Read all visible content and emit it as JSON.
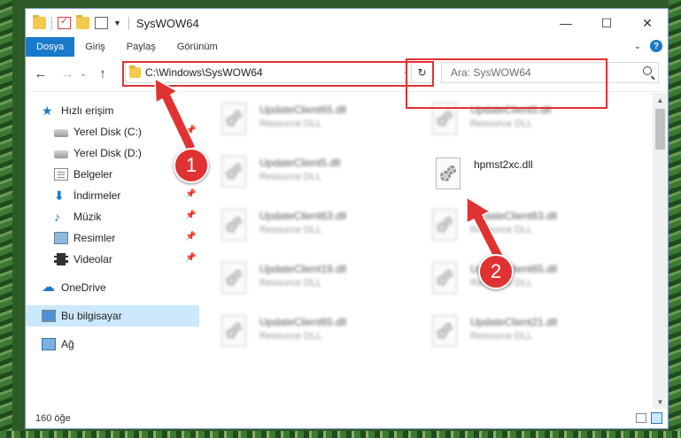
{
  "window": {
    "title": "SysWOW64",
    "minimize": "—",
    "maximize": "☐",
    "close": "✕"
  },
  "ribbon": {
    "tabs": [
      "Dosya",
      "Giriş",
      "Paylaş",
      "Görünüm"
    ],
    "help": "?",
    "expand": "⌄"
  },
  "nav": {
    "back": "←",
    "forward": "→",
    "recent": "⌄",
    "up": "↑",
    "address": "C:\\Windows\\SysWOW64",
    "address_dropdown": "⌄",
    "refresh": "↻",
    "search_placeholder": "Ara: SysWOW64"
  },
  "sidebar": {
    "items": [
      {
        "label": "Hızlı erişim",
        "icon": "star-icon",
        "pinned": false
      },
      {
        "label": "Yerel Disk (C:)",
        "icon": "drive-icon",
        "pinned": true
      },
      {
        "label": "Yerel Disk (D:)",
        "icon": "drive-icon",
        "pinned": false
      },
      {
        "label": "Belgeler",
        "icon": "documents-icon",
        "pinned": false
      },
      {
        "label": "İndirmeler",
        "icon": "downloads-icon",
        "pinned": true
      },
      {
        "label": "Müzik",
        "icon": "music-icon",
        "pinned": true
      },
      {
        "label": "Resimler",
        "icon": "pictures-icon",
        "pinned": true
      },
      {
        "label": "Videolar",
        "icon": "videos-icon",
        "pinned": true
      },
      {
        "label": "OneDrive",
        "icon": "cloud-icon",
        "pinned": false
      },
      {
        "label": "Bu bilgisayar",
        "icon": "pc-icon",
        "pinned": false
      },
      {
        "label": "Ağ",
        "icon": "network-icon",
        "pinned": false
      }
    ],
    "pin_glyph": "📌"
  },
  "files": [
    {
      "name": "UpdateClient65.dll",
      "type": "Resource DLL"
    },
    {
      "name": "UpdateClient5.dll",
      "type": "Resource DLL"
    },
    {
      "name": "UpdateClient5.dll",
      "type": "Resource DLL"
    },
    {
      "name": "hpmst2xc.dll",
      "type": ""
    },
    {
      "name": "UpdateClient63.dll",
      "type": "Resource DLL"
    },
    {
      "name": "UpdateClient63.dll",
      "type": "Resource DLL"
    },
    {
      "name": "UpdateClient19.dll",
      "type": "Resource DLL"
    },
    {
      "name": "UpdateClient65.dll",
      "type": "Resource DLL"
    },
    {
      "name": "UpdateClient65.dll",
      "type": "Resource DLL"
    },
    {
      "name": "UpdateClient21.dll",
      "type": "Resource DLL"
    }
  ],
  "callouts": [
    "1",
    "2"
  ],
  "status": {
    "count": "160 öğe"
  },
  "scroll": {
    "up": "▲",
    "down": "▼"
  },
  "colors": {
    "accent": "#1979ca",
    "highlight": "#e03232"
  }
}
